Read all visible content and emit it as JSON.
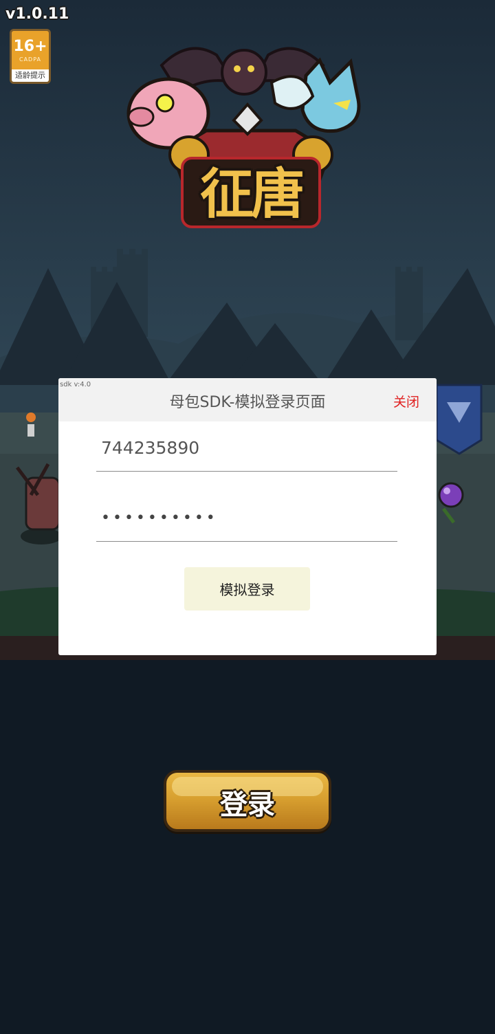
{
  "app": {
    "version": "v1.0.11",
    "age_rating": {
      "age": "16+",
      "org": "CADPA",
      "hint": "适龄提示"
    },
    "logo_title": "征唐",
    "login_button_label": "登录"
  },
  "sdk_dialog": {
    "sdk_version": "sdk v:4.0",
    "title": "母包SDK-模拟登录页面",
    "close_label": "关闭",
    "account": {
      "value": "744235890"
    },
    "password": {
      "value": "••••••••••"
    },
    "submit_label": "模拟登录"
  },
  "colors": {
    "close_text": "#e02020",
    "submit_bg": "#f5f4dc",
    "game_button": "#d8a030"
  }
}
